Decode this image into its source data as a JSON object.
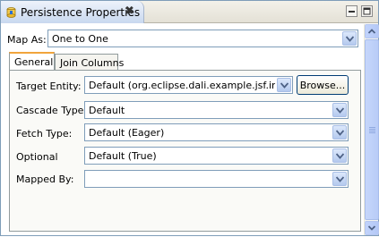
{
  "view": {
    "title": "Persistence Properties",
    "icon": "persistence-icon",
    "close_glyph": "✖"
  },
  "map_as": {
    "label": "Map As:",
    "value": "One to One"
  },
  "tabs": [
    {
      "label": "General",
      "active": true
    },
    {
      "label": "Join Columns",
      "active": false
    }
  ],
  "general": {
    "target_entity": {
      "label": "Target Entity:",
      "value": "Default (org.eclipse.dali.example.jsf.inver",
      "browse_label": "Browse..."
    },
    "cascade_type": {
      "label": "Cascade Type:",
      "value": "Default"
    },
    "fetch_type": {
      "label": "Fetch Type:",
      "value": "Default (Eager)"
    },
    "optional": {
      "label": "Optional",
      "value": "Default (True)"
    },
    "mapped_by": {
      "label": "Mapped By:",
      "value": ""
    }
  },
  "colors": {
    "accent": "#f1a43c",
    "border": "#7f9db9",
    "scroll": "#b4c8f6"
  }
}
